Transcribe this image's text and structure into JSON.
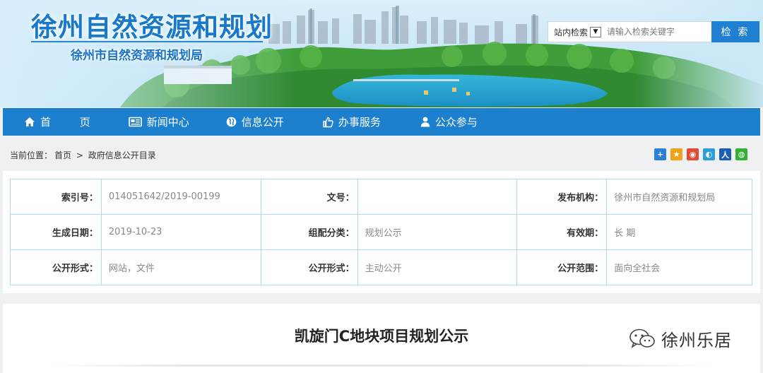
{
  "header": {
    "site_title": "徐州自然资源和规划",
    "site_subtitle": "徐州市自然资源和规划局",
    "search": {
      "scope": "站内检索",
      "placeholder": "请输入检索关键字",
      "button": "检 索"
    }
  },
  "nav": {
    "items": [
      {
        "label": "首 页",
        "icon": "home-icon"
      },
      {
        "label": "新闻中心",
        "icon": "newspaper-icon"
      },
      {
        "label": "信息公开",
        "icon": "globe-icon"
      },
      {
        "label": "办事服务",
        "icon": "thumbs-up-icon"
      },
      {
        "label": "公众参与",
        "icon": "person-icon"
      }
    ]
  },
  "breadcrumb": {
    "prefix": "当前位置：",
    "home": "首页",
    "separator": ">",
    "current": "政府信息公开目录"
  },
  "share_icons": [
    {
      "name": "share-more-icon",
      "color": "#2b7fd4"
    },
    {
      "name": "share-qzone-icon",
      "color": "#f0a21a"
    },
    {
      "name": "share-weibo-icon",
      "color": "#e24a33"
    },
    {
      "name": "share-tencent-icon",
      "color": "#2a9fd8"
    },
    {
      "name": "share-renren-icon",
      "color": "#1a5fb4"
    },
    {
      "name": "share-wechat-icon",
      "color": "#35b034"
    }
  ],
  "meta": {
    "rows": [
      [
        {
          "key": "索引号：",
          "value": "014051642/2019-00199"
        },
        {
          "key": "文号：",
          "value": ""
        },
        {
          "key": "发布机构：",
          "value": "徐州市自然资源和规划局"
        }
      ],
      [
        {
          "key": "生成日期：",
          "value": "2019-10-23"
        },
        {
          "key": "组配分类：",
          "value": "规划公示"
        },
        {
          "key": "有效期：",
          "value": "长 期"
        }
      ],
      [
        {
          "key": "公开形式：",
          "value": "网站，文件"
        },
        {
          "key": "公开形式：",
          "value": "主动公开"
        },
        {
          "key": "公开范围：",
          "value": "面向全社会"
        }
      ]
    ]
  },
  "article": {
    "title": "凯旋门C地块项目规划公示"
  },
  "watermark": {
    "text": "徐州乐居",
    "icon": "wechat-logo-icon"
  },
  "colors": {
    "brand_blue": "#1c80cf",
    "table_border": "#a9dcef"
  }
}
